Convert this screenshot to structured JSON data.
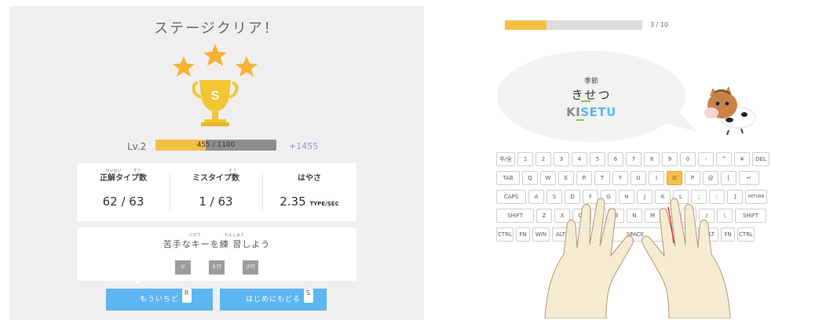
{
  "result": {
    "title": "ステージクリア！",
    "rank": "S",
    "stars": 3,
    "level": {
      "label": "Lv.2",
      "progress_text": "455 / 1100",
      "current": 455,
      "max": 1100,
      "gain": "+1455"
    },
    "stats": [
      {
        "furigana": "せいかい　　　すう",
        "label": "正解タイプ数",
        "value": "62 / 63",
        "unit": ""
      },
      {
        "furigana": "すう",
        "label": "ミスタイプ数",
        "value": "1 / 63",
        "unit": ""
      },
      {
        "furigana": "",
        "label": "はやさ",
        "value": "2.35",
        "unit": "TYPE/SEC"
      }
    ],
    "practice": {
      "furigana": "にがて　　　　　　れんしゅう",
      "message": "苦手なキーを練 習しよう",
      "chips": [
        "せ",
        "た行",
        "さ行"
      ]
    },
    "buttons": {
      "retry_label": "もういちど",
      "retry_key": "R",
      "home_label": "はじめにもどる",
      "home_key": "S"
    }
  },
  "typing": {
    "progress_text": "3 / 10",
    "progress_fraction": 0.3,
    "word_kanji": "季節",
    "word_kana": "きせつ",
    "roman_done": "KI",
    "roman_todo": "SETU",
    "active_key": "O"
  },
  "keyboard": {
    "rows": [
      [
        "半/全",
        "1",
        "2",
        "3",
        "4",
        "5",
        "6",
        "7",
        "8",
        "9",
        "0",
        "-",
        "^",
        "¥",
        "DEL"
      ],
      [
        "TAB",
        "Q",
        "W",
        "E",
        "R",
        "T",
        "Y",
        "U",
        "I",
        "O",
        "P",
        "@",
        "[",
        "↵"
      ],
      [
        "CAPS",
        "A",
        "S",
        "D",
        "F",
        "G",
        "H",
        "J",
        "K",
        "L",
        ";",
        ":",
        "]",
        "RETURN"
      ],
      [
        "SHIFT",
        "Z",
        "X",
        "C",
        "V",
        "B",
        "N",
        "M",
        ",",
        ".",
        "/",
        "\\",
        "SHIFT"
      ],
      [
        "CTRL",
        "FN",
        "WIN",
        "ALT",
        "SPACE",
        "ALT",
        "FN",
        "CTRL"
      ]
    ]
  },
  "colors": {
    "accent_yellow": "#f4bf45",
    "accent_blue": "#5db6f1",
    "success_green": "#88c64a",
    "level_gain": "#9a8ede",
    "panel_bg": "#efefef"
  },
  "icons": [
    "star-icon",
    "trophy-icon",
    "pony-mascot",
    "hands-overlay"
  ]
}
